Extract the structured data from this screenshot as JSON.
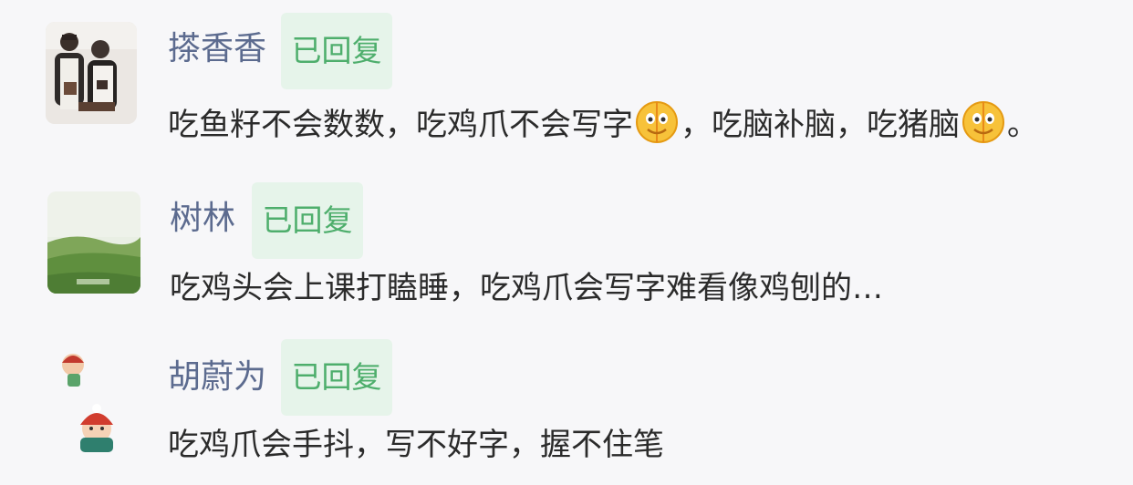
{
  "comments": [
    {
      "name": "搽香香",
      "badge": "已回复",
      "text_part1": "吃鱼籽不会数数，吃鸡爪不会写字",
      "text_part2": "，吃脑补脑，吃猪脑",
      "text_part3": "。",
      "avatar_icon": "couple-photo-avatar",
      "emoji_icon": "grinning-face-emoji"
    },
    {
      "name": "树林",
      "badge": "已回复",
      "text": "吃鸡头会上课打瞌睡，吃鸡爪会写字难看像鸡刨的…",
      "avatar_icon": "landscape-photo-avatar"
    },
    {
      "name": "胡蔚为",
      "badge": "已回复",
      "text": "吃鸡爪会手抖，写不好字，握不住笔",
      "avatar_icon": "cartoon-kids-avatar"
    }
  ],
  "colors": {
    "name": "#5c6b8f",
    "badge_bg": "#e6f4ea",
    "badge_text": "#4eae6c",
    "text": "#2b2b2b",
    "background": "#f7f7f9"
  }
}
